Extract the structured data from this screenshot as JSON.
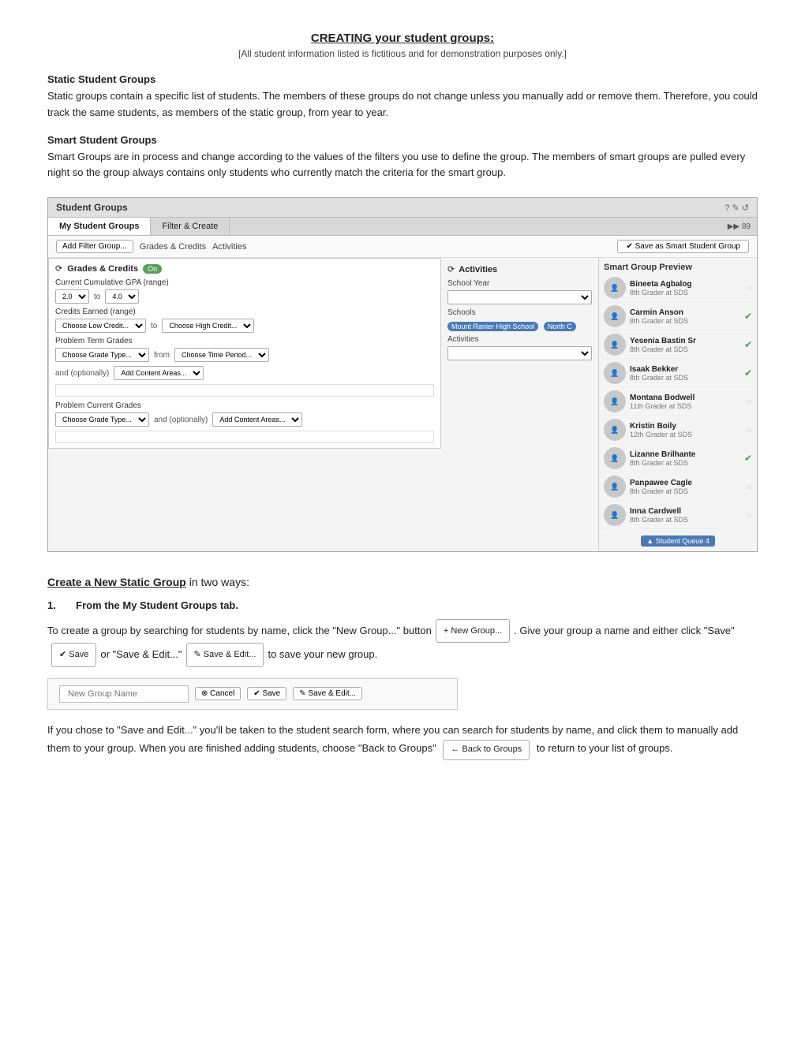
{
  "page": {
    "title": "CREATING your student groups:",
    "subtitle": "[All student information listed is fictitious and for demonstration purposes only.]",
    "static_title": "Static Student Groups",
    "static_text": "Static groups contain a specific list of students. The members of these groups do not change unless you manually add or remove them. Therefore, you could track the same students, as members of the static group, from year to year.",
    "smart_title": "Smart Student Groups",
    "smart_text": "Smart Groups are in process and change according to the values of the filters you use to define the group.  The members of smart groups are pulled every night so the group always contains only students who currently match the criteria for the smart group."
  },
  "screenshot": {
    "header_title": "Student Groups",
    "header_icons": "? ✎ ↺",
    "tabs": [
      "My Student Groups",
      "Filter & Create"
    ],
    "active_tab": "Filter & Create",
    "toolbar": {
      "add_filter": "Add Filter Group...",
      "grades_label": "Grades & Credits",
      "activities_label": "Activities",
      "save_smart": "✔ Save as Smart Student Group"
    },
    "grades_section": {
      "title": "Grades & Credits",
      "toggle": "On",
      "gpa_label": "Current Cumulative GPA (range)",
      "gpa_from": "2.0",
      "gpa_to_label": "to",
      "gpa_to": "4.0",
      "credits_label": "Credits Earned (range)",
      "credits_from": "Choose Low Credit...",
      "credits_to_label": "to",
      "credits_to": "Choose High Credit...",
      "problem_term_label": "Problem Term Grades",
      "grade_type": "Choose Grade Type...",
      "from_label": "from",
      "time_period": "Choose Time Period...",
      "and_optional": "and (optionally)",
      "content_areas": "Add Content Areas...",
      "problem_current_label": "Problem Current Grades",
      "current_grade_type": "Choose Grade Type...",
      "current_and_optional": "and (optionally)",
      "current_content": "Add Content Areas..."
    },
    "activities_section": {
      "title": "Activities",
      "school_year_label": "School Year",
      "schools_label": "Schools",
      "school_tags": [
        "Mount Ranier High School",
        "North C"
      ],
      "activities_label": "Activities"
    },
    "smart_preview": {
      "title": "Smart Group Preview",
      "students": [
        {
          "name": "Bineeta Agbalog",
          "grade": "8th Grader at SDS",
          "checked": false
        },
        {
          "name": "Carmin Anson",
          "grade": "8th Grader at SDS",
          "checked": true
        },
        {
          "name": "Yesenia Bastin Sr",
          "grade": "8th Grader at SDS",
          "checked": true
        },
        {
          "name": "Isaak Bekker",
          "grade": "8th Grader at SDS",
          "checked": true
        },
        {
          "name": "Montana Bodwell",
          "grade": "11th Grader at SDS",
          "checked": false
        },
        {
          "name": "Kristin Boily",
          "grade": "12th Grader at SDS",
          "checked": false
        },
        {
          "name": "Lizanne Brilhante",
          "grade": "8th Grader at SDS",
          "checked": true
        },
        {
          "name": "Panpawee Cagle",
          "grade": "8th Grader at SDS",
          "checked": false
        },
        {
          "name": "Inna Cardwell",
          "grade": "8th Grader at SDS",
          "checked": false
        }
      ],
      "queue_btn": "▲ Student Queue 4"
    }
  },
  "static_section": {
    "heading": "Create a New Static Group",
    "in_two_ways": " in two ways:",
    "step1_num": "1.",
    "step1_label": "From the My Student Groups tab.",
    "new_group_btn": "+ New Group...",
    "desc1": "To create a group by searching for students by name, click the \"New Group...\" button",
    "desc2": ". Give your group a name and either click \"Save\"",
    "save_btn": "✔ Save",
    "or_text": "or \"Save & Edit...\"",
    "save_edit_btn": "✎ Save & Edit...",
    "to_save": "to save your new group.",
    "new_group_form": {
      "placeholder": "New Group Name",
      "cancel_btn": "⊗ Cancel",
      "save_btn": "✔ Save",
      "save_edit_btn": "✎ Save & Edit..."
    },
    "desc3": "If you chose to \"Save and Edit...\" you'll be taken to the student search form, where you can search for students by name, and click them to manually add them to your group. When you are finished adding students, choose \"Back to Groups\"",
    "back_btn": "← Back to Groups",
    "desc4": "to return to your list of groups."
  }
}
